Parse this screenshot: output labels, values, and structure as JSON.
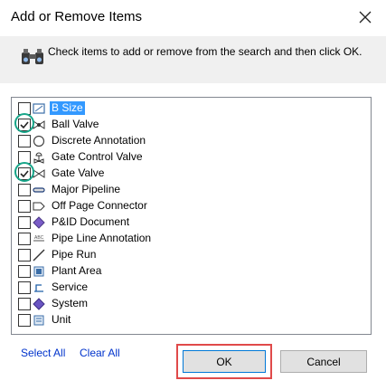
{
  "dialog": {
    "title": "Add or Remove Items",
    "instruction": "Check items to add or remove from the search and then click OK."
  },
  "items": [
    {
      "label": "B Size",
      "checked": false,
      "selected": true,
      "icon": "size-icon"
    },
    {
      "label": "Ball Valve",
      "checked": true,
      "selected": false,
      "icon": "ball-valve-icon"
    },
    {
      "label": "Discrete Annotation",
      "checked": false,
      "selected": false,
      "icon": "annotation-icon"
    },
    {
      "label": "Gate Control Valve",
      "checked": false,
      "selected": false,
      "icon": "control-valve-icon"
    },
    {
      "label": "Gate Valve",
      "checked": true,
      "selected": false,
      "icon": "gate-valve-icon"
    },
    {
      "label": "Major Pipeline",
      "checked": false,
      "selected": false,
      "icon": "pipeline-icon"
    },
    {
      "label": "Off Page Connector",
      "checked": false,
      "selected": false,
      "icon": "connector-icon"
    },
    {
      "label": "P&ID Document",
      "checked": false,
      "selected": false,
      "icon": "document-icon"
    },
    {
      "label": "Pipe Line Annotation",
      "checked": false,
      "selected": false,
      "icon": "line-annotation-icon"
    },
    {
      "label": "Pipe Run",
      "checked": false,
      "selected": false,
      "icon": "pipe-run-icon"
    },
    {
      "label": "Plant Area",
      "checked": false,
      "selected": false,
      "icon": "plant-area-icon"
    },
    {
      "label": "Service",
      "checked": false,
      "selected": false,
      "icon": "service-icon"
    },
    {
      "label": "System",
      "checked": false,
      "selected": false,
      "icon": "system-icon"
    },
    {
      "label": "Unit",
      "checked": false,
      "selected": false,
      "icon": "unit-icon"
    }
  ],
  "links": {
    "select_all": "Select All",
    "clear_all": "Clear All"
  },
  "buttons": {
    "ok": "OK",
    "cancel": "Cancel"
  },
  "colors": {
    "selection": "#3399ff",
    "link": "#0033cc",
    "highlight": "#e04a4a",
    "check_circle": "#17a589"
  }
}
